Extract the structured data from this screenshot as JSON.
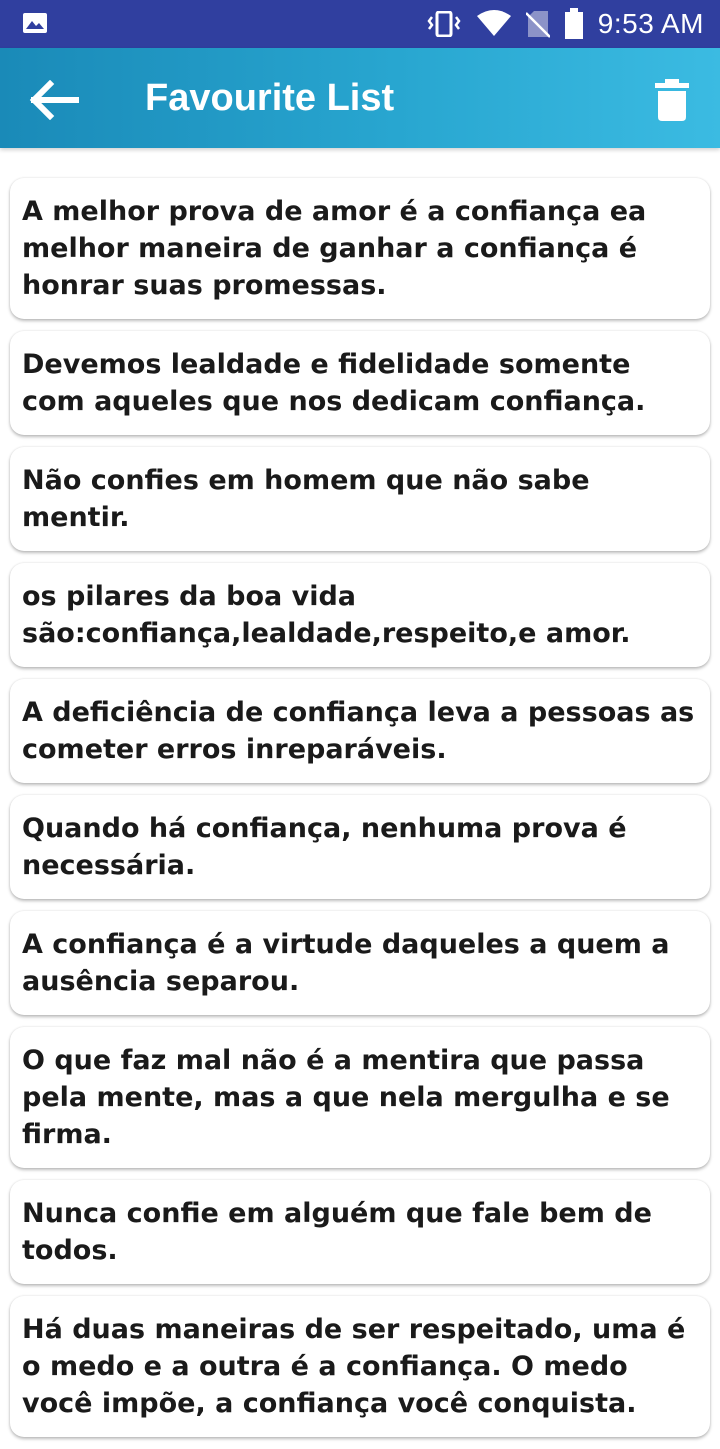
{
  "status_bar": {
    "time": "9:53 AM",
    "icons": [
      "image-icon",
      "vibrate-icon",
      "wifi-icon",
      "no-sim-icon",
      "battery-icon"
    ],
    "background": "#303f9f"
  },
  "app_bar": {
    "title": "Favourite List",
    "back_icon": "arrow-left-icon",
    "delete_icon": "trash-icon",
    "gradient": [
      "#1a8ab8",
      "#3bbbe2"
    ]
  },
  "quotes": [
    "A melhor prova de amor é a confiança ea melhor maneira de ganhar a confiança é honrar suas promessas.",
    "Devemos lealdade e fidelidade somente com aqueles que nos dedicam confiança.",
    "Não confies em homem que não sabe mentir.",
    "os pilares da boa vida são:confiança,lealdade,respeito,e amor.",
    "A deficiência de confiança leva a pessoas as cometer erros inreparáveis.",
    "Quando há confiança, nenhuma prova é necessária.",
    "A confiança é a virtude daqueles a quem a ausência separou.",
    "O que faz mal não é a mentira que passa pela mente, mas a que nela mergulha e se firma.",
    "Nunca confie em alguém que fale bem de todos.",
    "Há duas maneiras de ser respeitado, uma é o medo e a outra é a confiança. O medo você impõe, a confiança você conquista."
  ]
}
